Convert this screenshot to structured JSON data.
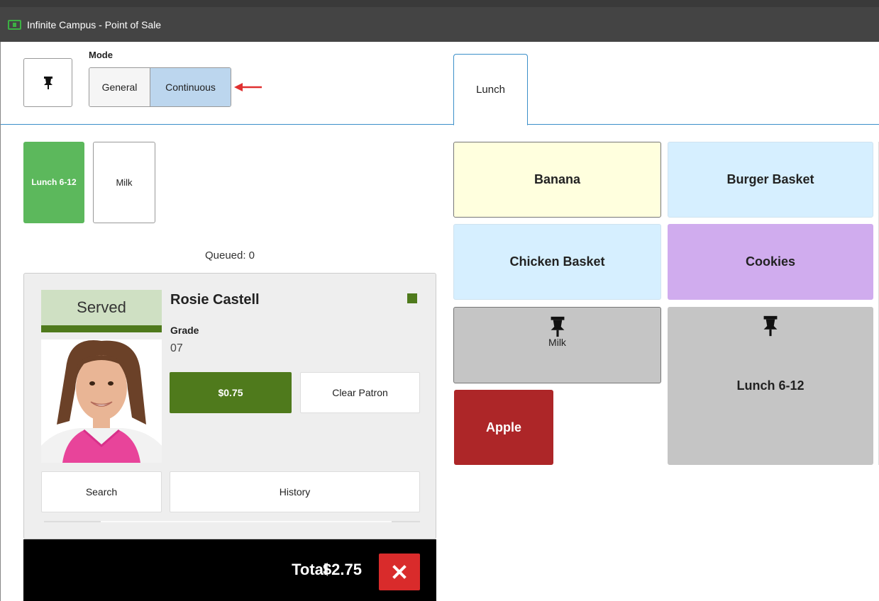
{
  "window": {
    "title": "Infinite Campus - Point of Sale"
  },
  "toolbar": {
    "mode_label": "Mode",
    "modes": [
      {
        "label": "General",
        "selected": false
      },
      {
        "label": "Continuous",
        "selected": true
      }
    ]
  },
  "tabs": [
    {
      "label": "Lunch",
      "active": true
    }
  ],
  "quick_buttons": [
    {
      "label": "Lunch 6-12",
      "color": "#5cb85c"
    },
    {
      "label": "Milk",
      "color": "#ffffff"
    }
  ],
  "queue": {
    "text": "Queued: 0"
  },
  "patron": {
    "status": "Served",
    "name": "Rosie Castell",
    "grade_label": "Grade",
    "grade_value": "07",
    "balance": "$0.75",
    "clear_label": "Clear Patron",
    "search_label": "Search",
    "history_label": "History"
  },
  "totals": {
    "label": "Total",
    "value": "$2.75"
  },
  "menu_items": {
    "banana": {
      "label": "Banana",
      "color": "#ffffde"
    },
    "burger": {
      "label": "Burger Basket",
      "color": "#d6efff"
    },
    "chicken": {
      "label": "Chicken Basket",
      "color": "#d6efff"
    },
    "cookies": {
      "label": "Cookies",
      "color": "#d0acee"
    },
    "milk": {
      "label": "Milk",
      "color": "#c5c5c5",
      "pinned": true
    },
    "lunch": {
      "label": "Lunch 6-12",
      "color": "#c5c5c5",
      "pinned": true
    },
    "apple": {
      "label": "Apple",
      "color": "#ad2628"
    }
  }
}
